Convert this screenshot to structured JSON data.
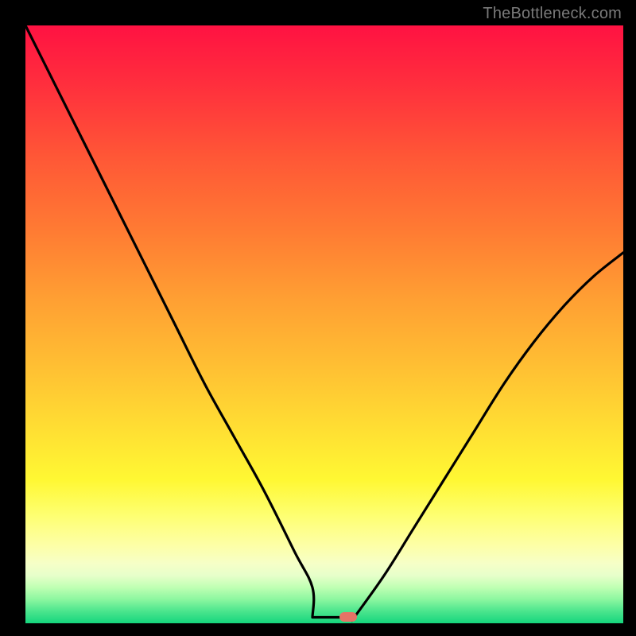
{
  "watermark": "TheBottleneck.com",
  "colors": {
    "curve_stroke": "#000000",
    "marker_fill": "#e57366",
    "frame_bg": "#000000"
  },
  "chart_data": {
    "type": "line",
    "title": "",
    "xlabel": "",
    "ylabel": "",
    "xlim": [
      0,
      100
    ],
    "ylim": [
      0,
      100
    ],
    "grid": false,
    "legend": false,
    "note": "Axes carry no tick labels in the image; values are read as percent of plot width/height. y=0 is the bottom (green) edge.",
    "series": [
      {
        "name": "bottleneck-curve",
        "x": [
          0,
          5,
          10,
          15,
          20,
          25,
          30,
          35,
          40,
          45,
          48,
          50,
          52,
          54,
          55,
          60,
          65,
          70,
          75,
          80,
          85,
          90,
          95,
          100
        ],
        "y": [
          100,
          90,
          80,
          70,
          60,
          50,
          40,
          31,
          22,
          12,
          6,
          2,
          1,
          1,
          1,
          8,
          16,
          24,
          32,
          40,
          47,
          53,
          58,
          62
        ]
      }
    ],
    "flat_segment": {
      "x_start": 48,
      "x_end": 55,
      "y": 1
    },
    "marker": {
      "x": 54,
      "y": 1,
      "shape": "pill"
    }
  }
}
